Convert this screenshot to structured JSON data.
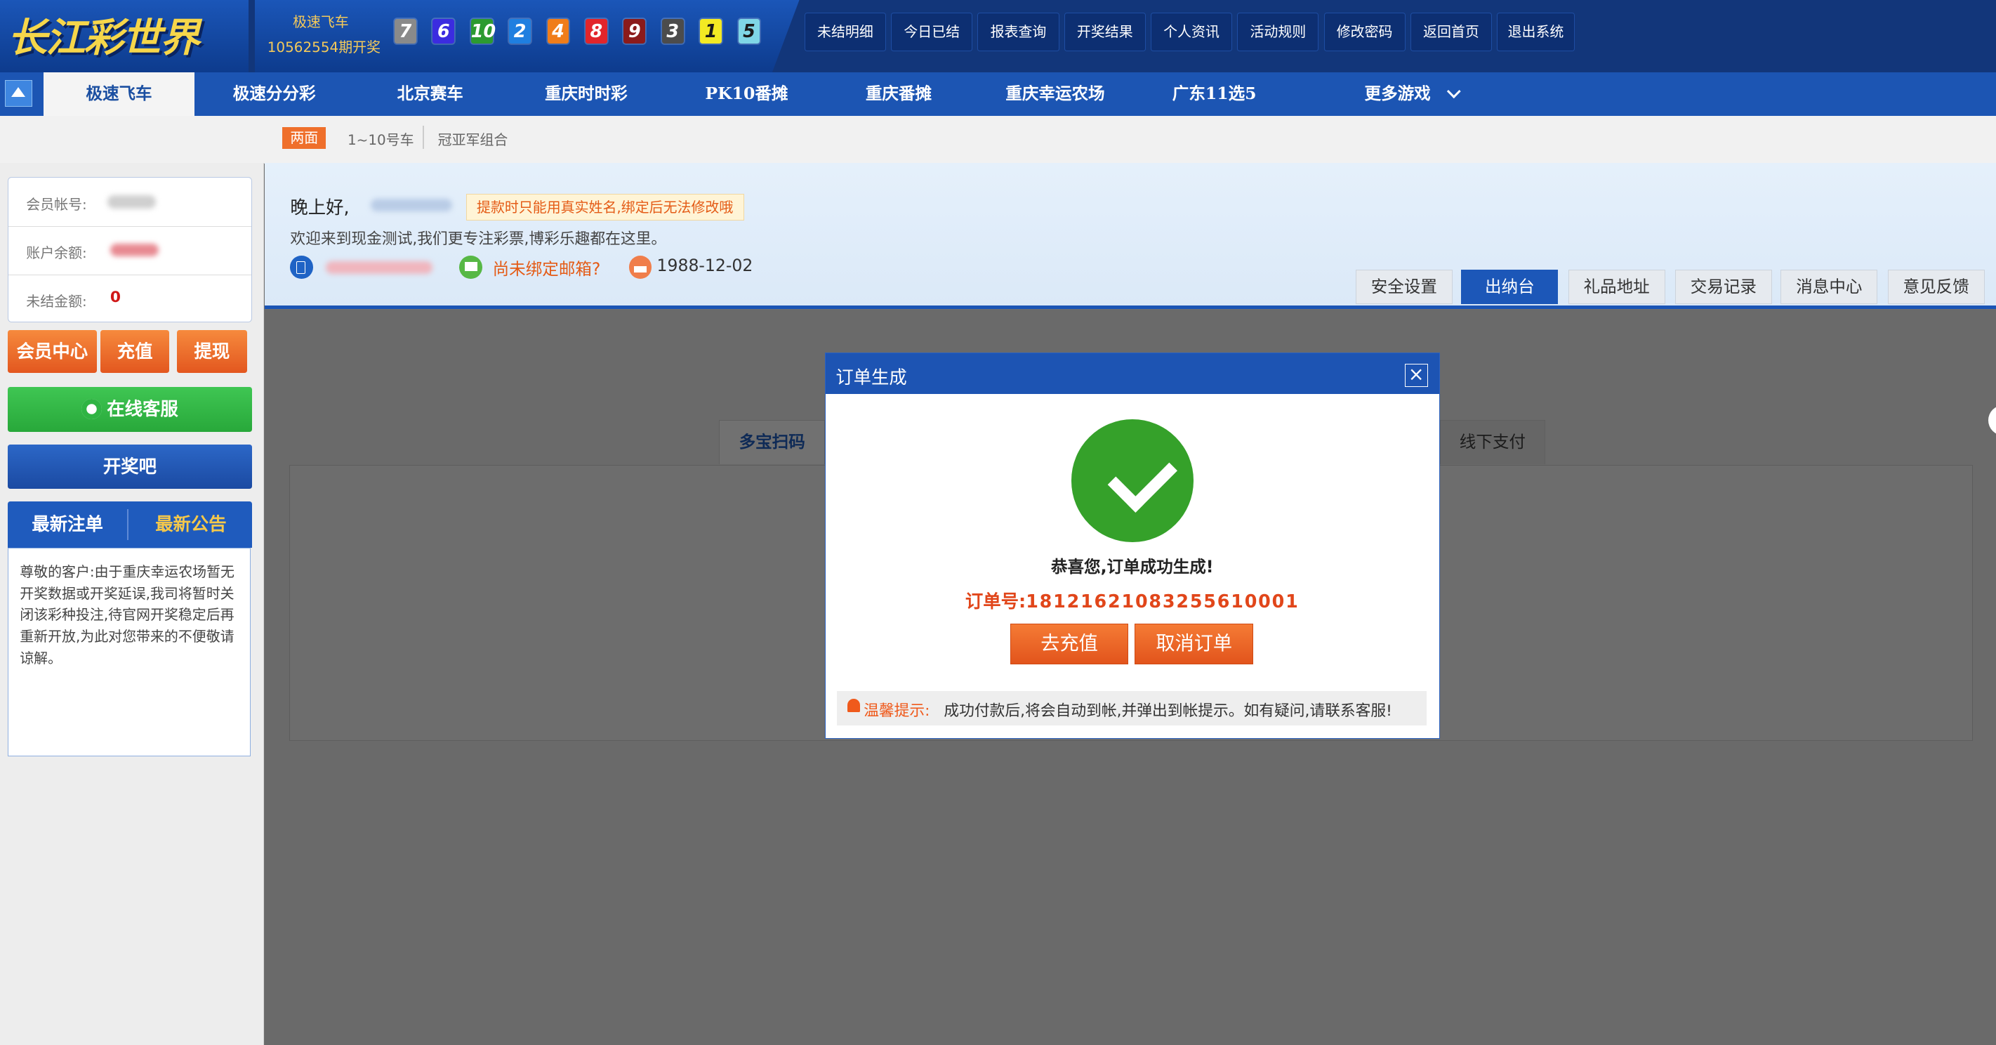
{
  "header": {
    "logo_text": "长江彩世界",
    "draw_game": "极速飞车",
    "draw_issue": "10562554期开奖",
    "balls": [
      {
        "n": "7",
        "color": "#8a8a8a"
      },
      {
        "n": "6",
        "color": "#3b2ce0"
      },
      {
        "n": "10",
        "color": "#2c9a30"
      },
      {
        "n": "2",
        "color": "#1f7fe0"
      },
      {
        "n": "4",
        "color": "#f07d1a"
      },
      {
        "n": "8",
        "color": "#e2252b"
      },
      {
        "n": "9",
        "color": "#8b1b1b"
      },
      {
        "n": "3",
        "color": "#4c4c4c"
      },
      {
        "n": "1",
        "color": "#f3ea23"
      },
      {
        "n": "5",
        "color": "#7fd6e6"
      }
    ],
    "nav": [
      "未结明细",
      "今日已结",
      "报表查询",
      "开奖结果",
      "个人资讯",
      "活动规则",
      "修改密码",
      "返回首页",
      "退出系统"
    ]
  },
  "games": {
    "active": "极速飞车",
    "tabs": [
      "极速分分彩",
      "北京赛车",
      "重庆时时彩",
      "PK10番摊",
      "重庆番摊",
      "重庆幸运农场",
      "广东11选5"
    ],
    "more": "更多游戏"
  },
  "subtabs": {
    "active": "两面",
    "items": [
      "1~10号车",
      "冠亚军组合"
    ]
  },
  "account": {
    "label_account": "会员帐号:",
    "label_balance": "账户余额:",
    "label_unsettled": "未结金额:",
    "unsettled_value": "0"
  },
  "sidebar": {
    "member_center": "会员中心",
    "recharge": "充值",
    "withdraw": "提现",
    "online_service": "在线客服",
    "kaijiangba": "开奖吧",
    "tab_latest_bets": "最新注单",
    "tab_latest_notice": "最新公告",
    "notice_text": "尊敬的客户:由于重庆幸运农场暂无开奖数据或开奖延误,我司将暂时关闭该彩种投注,待官网开奖稳定后再重新开放,为此对您带来的不便敬请谅解。"
  },
  "welcome": {
    "greeting": "晚上好,",
    "warning": "提款时只能用真实姓名,绑定后无法修改哦",
    "intro": "欢迎来到现金测试,我们更专注彩票,博彩乐趣都在这里。",
    "email_status": "尚未绑定邮箱?",
    "birthday": "1988-12-02"
  },
  "right_tabs": [
    "安全设置",
    "出纳台",
    "礼品地址",
    "交易记录",
    "消息中心",
    "意见反馈"
  ],
  "right_tab_active": "出纳台",
  "payment": {
    "tab_left": "多宝扫码",
    "tab_right": "线下支付"
  },
  "modal": {
    "title": "订单生成",
    "success_text": "恭喜您,订单成功生成!",
    "order_label": "订单号:",
    "order_no": "1812162108325561000​1",
    "btn_recharge": "去充值",
    "btn_cancel": "取消订单",
    "tip_label": "温馨提示:",
    "tip_text": "成功付款后,将会自动到帐,并弹出到帐提示。如有疑问,请联系客服!"
  }
}
